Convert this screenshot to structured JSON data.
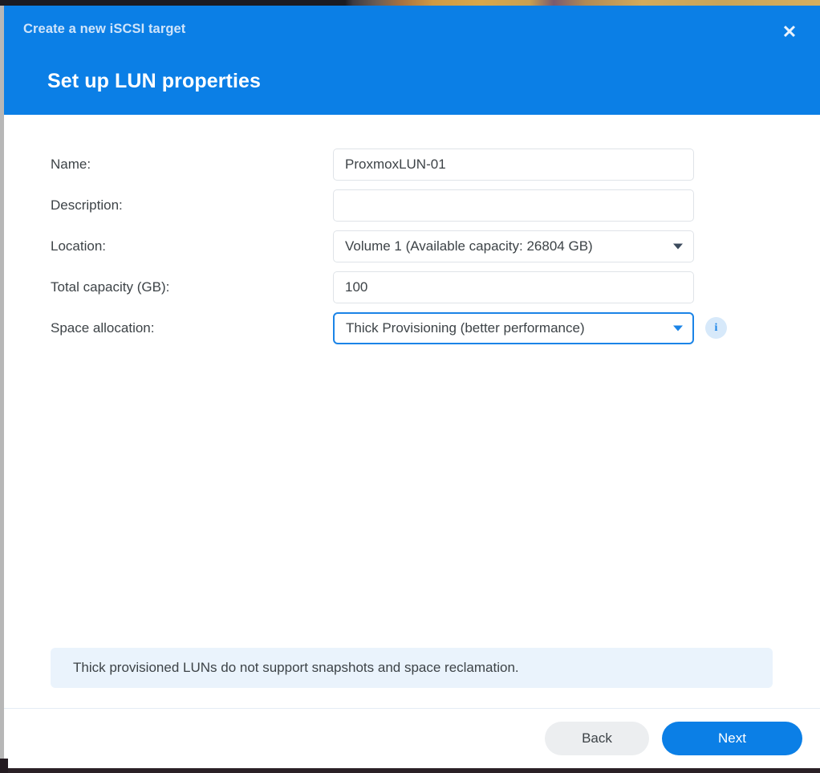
{
  "dialog": {
    "eyebrow": "Create a new iSCSI target",
    "title": "Set up LUN properties",
    "close_label": "✕"
  },
  "form": {
    "fields": [
      {
        "label": "Name:",
        "value": "ProxmoxLUN-01",
        "placeholder": ""
      },
      {
        "label": "Description:",
        "value": "",
        "placeholder": ""
      },
      {
        "label": "Location:",
        "value": "Volume 1 (Available capacity: 26804 GB)",
        "placeholder": ""
      },
      {
        "label": "Total capacity (GB):",
        "value": "100",
        "placeholder": ""
      },
      {
        "label": "Space allocation:",
        "value": "Thick Provisioning (better performance)",
        "placeholder": ""
      }
    ],
    "info_icon_glyph": "i"
  },
  "notice": {
    "text": "Thick provisioned LUNs do not support snapshots and space reclamation."
  },
  "footer": {
    "back_label": "Back",
    "next_label": "Next"
  },
  "colors": {
    "header_blue": "#0b7fe6",
    "accent_blue": "#1b84e7",
    "notice_bg": "#eaf3fc",
    "secondary_btn": "#eceef0",
    "text": "#3d4347"
  }
}
